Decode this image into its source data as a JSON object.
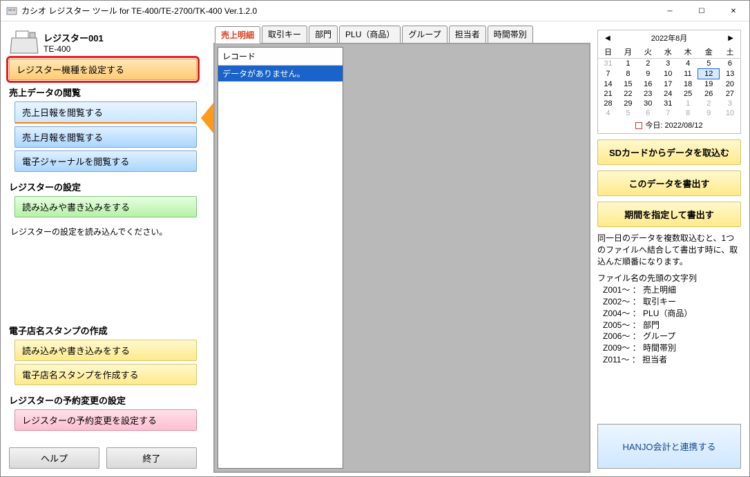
{
  "title": "カシオ レジスター ツール for TE-400/TE-2700/TK-400 Ver.1.2.0",
  "register": {
    "name": "レジスター001",
    "model": "TE-400"
  },
  "buttons": {
    "setModel": "レジスター機種を設定する",
    "daily": "売上日報を閲覧する",
    "monthly": "売上月報を閲覧する",
    "ejournal": "電子ジャーナルを閲覧する",
    "readWrite": "読み込みや書き込みをする",
    "stampRW": "読み込みや書き込みをする",
    "stampCreate": "電子店名スタンプを作成する",
    "reserve": "レジスターの予約変更を設定する",
    "help": "ヘルプ",
    "exit": "終了",
    "sdImport": "SDカードからデータを取込む",
    "exportThis": "このデータを書出す",
    "exportPeriod": "期間を指定して書出す",
    "hanjo": "HANJO会計と連携する"
  },
  "labels": {
    "salesBrowse": "売上データの閲覧",
    "regSettings": "レジスターの設定",
    "note": "レジスターの設定を読み込んでください。",
    "stamp": "電子店名スタンプの作成",
    "reserve": "レジスターの予約変更の設定",
    "listHeader": "レコード",
    "listEmpty": "データがありません。",
    "info": "同一日のデータを複数取込むと、1つのファイルへ結合して書出す時に、取込んだ順番になります。",
    "prefixHead": "ファイル名の先頭の文字列"
  },
  "tabs": [
    "売上明細",
    "取引キー",
    "部門",
    "PLU（商品）",
    "グループ",
    "担当者",
    "時間帯別"
  ],
  "activeTab": 0,
  "calendar": {
    "title": "2022年8月",
    "dow": [
      "日",
      "月",
      "火",
      "水",
      "木",
      "金",
      "土"
    ],
    "weeks": [
      [
        {
          "d": "31",
          "g": true
        },
        {
          "d": "1"
        },
        {
          "d": "2"
        },
        {
          "d": "3"
        },
        {
          "d": "4"
        },
        {
          "d": "5"
        },
        {
          "d": "6"
        }
      ],
      [
        {
          "d": "7"
        },
        {
          "d": "8"
        },
        {
          "d": "9"
        },
        {
          "d": "10"
        },
        {
          "d": "11"
        },
        {
          "d": "12",
          "sel": true
        },
        {
          "d": "13"
        }
      ],
      [
        {
          "d": "14"
        },
        {
          "d": "15"
        },
        {
          "d": "16"
        },
        {
          "d": "17"
        },
        {
          "d": "18"
        },
        {
          "d": "19"
        },
        {
          "d": "20"
        }
      ],
      [
        {
          "d": "21"
        },
        {
          "d": "22"
        },
        {
          "d": "23"
        },
        {
          "d": "24"
        },
        {
          "d": "25"
        },
        {
          "d": "26"
        },
        {
          "d": "27"
        }
      ],
      [
        {
          "d": "28"
        },
        {
          "d": "29"
        },
        {
          "d": "30"
        },
        {
          "d": "31"
        },
        {
          "d": "1",
          "g": true
        },
        {
          "d": "2",
          "g": true
        },
        {
          "d": "3",
          "g": true
        }
      ],
      [
        {
          "d": "4",
          "g": true
        },
        {
          "d": "5",
          "g": true
        },
        {
          "d": "6",
          "g": true
        },
        {
          "d": "7",
          "g": true
        },
        {
          "d": "8",
          "g": true
        },
        {
          "d": "9",
          "g": true
        },
        {
          "d": "10",
          "g": true
        }
      ]
    ],
    "today": "今日: 2022/08/12"
  },
  "prefixes": [
    "Z001～ ： 売上明細",
    "Z002～ ： 取引キー",
    "Z004～ ： PLU（商品）",
    "Z005～ ： 部門",
    "Z006～ ： グループ",
    "Z009～ ： 時間帯別",
    "Z011～ ： 担当者"
  ]
}
